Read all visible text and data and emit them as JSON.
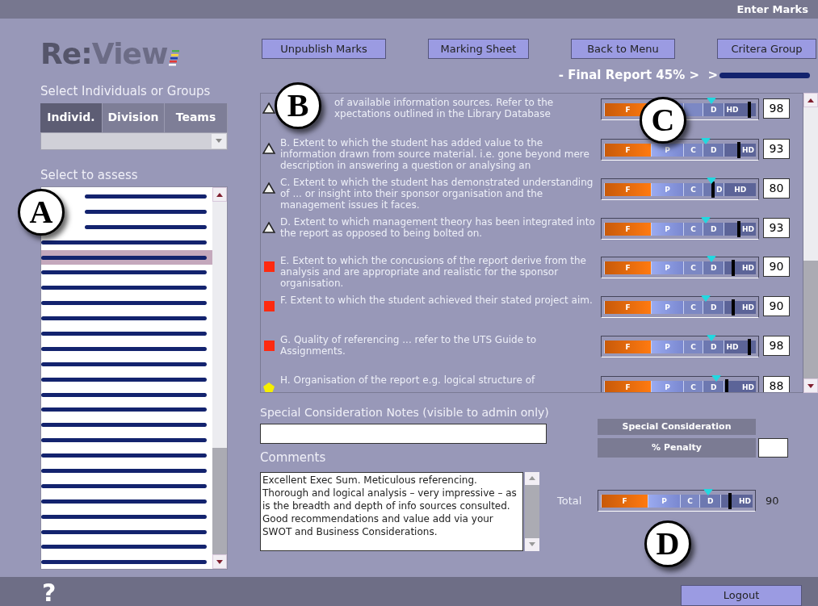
{
  "header": {
    "title": "Enter Marks"
  },
  "logo": {
    "first": "Re:",
    "second": "View"
  },
  "group_select": {
    "label": "Select Individuals or Groups",
    "tabs": [
      {
        "label": "Individ.",
        "selected": true
      },
      {
        "label": "Division",
        "selected": false
      },
      {
        "label": "Teams",
        "selected": false
      }
    ]
  },
  "assess_list": {
    "label": "Select to assess",
    "items": [
      {
        "selected": false
      },
      {
        "selected": false
      },
      {
        "selected": false
      },
      {
        "selected": false
      },
      {
        "selected": true
      },
      {
        "selected": false
      },
      {
        "selected": false
      },
      {
        "selected": false
      },
      {
        "selected": false
      },
      {
        "selected": false
      },
      {
        "selected": false
      },
      {
        "selected": false
      },
      {
        "selected": false
      },
      {
        "selected": false
      },
      {
        "selected": false
      },
      {
        "selected": false
      },
      {
        "selected": false
      },
      {
        "selected": false
      },
      {
        "selected": false
      },
      {
        "selected": false
      },
      {
        "selected": false
      },
      {
        "selected": false
      },
      {
        "selected": false
      },
      {
        "selected": false
      },
      {
        "selected": false
      }
    ]
  },
  "toolbar": [
    "Unpublish Marks",
    "Marking Sheet",
    "Back to Menu",
    "Critera Group"
  ],
  "breadcrumb": {
    "text": "- Final Report 45% >  >"
  },
  "criteria": [
    {
      "kind": "triangle",
      "text": "of available information sources. Refer to the xpectations outlined in the Library Database",
      "bands": [
        "F",
        "D",
        "HD"
      ],
      "pointer": {
        "level": 0.71
      },
      "score_marker": {
        "level": 0.96
      },
      "mark": "98"
    },
    {
      "kind": "triangle",
      "text": "B. Extent to which the student has added value to the information drawn from source material. i.e. gone beyond mere description in answering a question or analysing an",
      "bands": [
        "F",
        "P",
        "C",
        "D",
        "HD"
      ],
      "pointer": {
        "level": 0.67
      },
      "score_marker": {
        "level": 0.89
      },
      "mark": "93"
    },
    {
      "kind": "triangle",
      "text": "C. Extent to which the student has demonstrated understanding of ... or insight into their sponsor organisation and the management issues it faces.",
      "bands": [
        "F",
        "P",
        "C",
        "D",
        "HD"
      ],
      "pointer": {
        "level": 0.71
      },
      "score_marker": {
        "level": 0.72
      },
      "mark": "80"
    },
    {
      "kind": "triangle",
      "text": "D. Extent to which management theory has been integrated into the report as opposed to being  bolted on.",
      "bands": [
        "F",
        "P",
        "C",
        "D",
        "HD"
      ],
      "pointer": {
        "level": 0.67
      },
      "score_marker": {
        "level": 0.89
      },
      "mark": "93"
    },
    {
      "kind": "square",
      "text": "E. Extent to which the concusions of the report derive from the analysis and are appropriate and realistic for the sponsor organisation.",
      "bands": [
        "F",
        "P",
        "C",
        "D",
        "HD"
      ],
      "pointer": {
        "level": 0.71
      },
      "score_marker": {
        "level": 0.85
      },
      "mark": "90"
    },
    {
      "kind": "square",
      "text": "F. Extent to which the student achieved their stated project aim.",
      "bands": [
        "F",
        "P",
        "C",
        "D",
        "HD"
      ],
      "pointer": {
        "level": 0.67
      },
      "score_marker": {
        "level": 0.85
      },
      "mark": "90"
    },
    {
      "kind": "square",
      "text": "G. Quality of referencing ... refer to the UTS Guide to Assignments.",
      "bands": [
        "F",
        "P",
        "C",
        "D",
        "HD"
      ],
      "pointer": {
        "level": 0.71
      },
      "score_marker": {
        "level": 0.96
      },
      "mark": "98"
    },
    {
      "kind": "pentagon",
      "text": "H. Organisation of the report e.g. logical structure of",
      "bands": [
        "F",
        "P",
        "C",
        "D",
        "HD"
      ],
      "pointer": {
        "level": 0.74
      },
      "score_marker": {
        "level": 0.81
      },
      "mark": "88"
    }
  ],
  "special_notes": {
    "label": "Special Consideration Notes (visible to admin only)"
  },
  "comments": {
    "label": "Comments",
    "value": "Excellent Exec Sum. Meticulous referencing. Thorough and logical analysis – very impressive – as is the breadth and depth of info sources consulted. Good recommendations and value add via your SWOT and Business Considerations."
  },
  "special_consideration": {
    "title": "Special Consideration",
    "penalty_label": "% Penalty"
  },
  "total": {
    "label": "Total",
    "bands": [
      "F",
      "P",
      "C",
      "D",
      "HD"
    ],
    "pointer": {
      "level": 0.71
    },
    "score_marker": {
      "level": 0.85
    },
    "mark": "90"
  },
  "footer": {
    "help": "?",
    "logout": "Logout"
  },
  "callouts": [
    {
      "label": "A"
    },
    {
      "label": "B"
    },
    {
      "label": "C"
    },
    {
      "label": "D"
    }
  ]
}
